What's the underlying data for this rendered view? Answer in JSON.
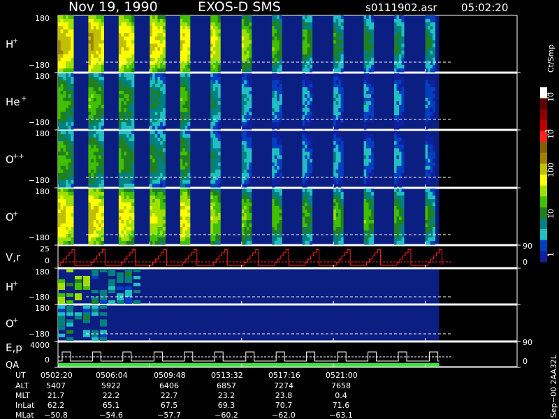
{
  "header": {
    "date": "Nov 19, 1990",
    "instrument": "EXOS-D SMS",
    "file": "s0111902.asr",
    "start_time": "05:02:20"
  },
  "colors": {
    "background": "#000000",
    "panel_bg": "#0b1e82",
    "dashed_line": "#ffffff",
    "vr_trace": "#ff2020",
    "qa_bar": "#40e040"
  },
  "colorbar": {
    "label": "Ct/Smp",
    "ticks": [
      "10",
      "10",
      "100",
      "10",
      "1"
    ],
    "tick_exponents": [
      "4",
      "3",
      "",
      "",
      ""
    ],
    "colors": [
      "#ffffff",
      "#600000",
      "#900000",
      "#c00000",
      "#ff2020",
      "#806000",
      "#a08000",
      "#c0c000",
      "#ffff00",
      "#a0e000",
      "#40c000",
      "#208020",
      "#008080",
      "#20c0c0",
      "#0040c0",
      "#1020a0"
    ]
  },
  "panels": [
    {
      "id": "h_plus",
      "label": "H",
      "sup": "+",
      "ytop": "180",
      "ybot": "−180"
    },
    {
      "id": "he_plus",
      "label": "He",
      "sup": "+",
      "ytop": "180",
      "ybot": "−180"
    },
    {
      "id": "o_plusplus",
      "label": "O",
      "sup": "++",
      "ytop": "180",
      "ybot": "−180"
    },
    {
      "id": "o_plus",
      "label": "O",
      "sup": "+",
      "ytop": "180",
      "ybot": "−180"
    },
    {
      "id": "vr",
      "label": "V,r",
      "sup": "",
      "ytop": "25",
      "ybot": "0",
      "right_top": "90",
      "right_bot": "0"
    },
    {
      "id": "h_plus_2",
      "label": "H",
      "sup": "+",
      "ytop": "180",
      "ybot": "−180"
    },
    {
      "id": "o_plus_2",
      "label": "O",
      "sup": "+",
      "ytop": "180",
      "ybot": "−180"
    },
    {
      "id": "ep_qa",
      "label": "E,p",
      "label2": "QA",
      "sup": "",
      "ytop": "4000",
      "ybot": "0",
      "right_top": "90",
      "right_bot": "0"
    }
  ],
  "ephemeris": {
    "labels": [
      "UT",
      "ALT",
      "MLT",
      "InLat",
      "MLat"
    ],
    "columns": [
      [
        "0502:20",
        "5407",
        "21.7",
        "62.2",
        "−50.8"
      ],
      [
        "0506:04",
        "5922",
        "22.2",
        "65.1",
        "−54.6"
      ],
      [
        "0509:48",
        "6406",
        "22.7",
        "67.5",
        "−57.7"
      ],
      [
        "0513:32",
        "6857",
        "23.2",
        "69.3",
        "−60.2"
      ],
      [
        "0517:16",
        "7274",
        "23.8",
        "70.7",
        "−62.0"
      ],
      [
        "0521:00",
        "7658",
        "0.4",
        "71.6",
        "−63.1"
      ]
    ]
  },
  "footer": {
    "version": "Sep−00 2AA32L"
  },
  "chart_data": {
    "type": "heatmap",
    "title": "Nov 19, 1990    EXOS-D SMS",
    "x_ticks": [
      "0502:20",
      "0506:04",
      "0509:48",
      "0513:32",
      "0517:16",
      "0521:00"
    ],
    "xlim": [
      "05:02:20",
      "05:21:00"
    ],
    "data_end": "05:17:50",
    "pitch_angle_range": [
      -180,
      180
    ],
    "burst_starts": [
      "05:02:20",
      "05:03:34",
      "05:04:48",
      "05:06:04",
      "05:07:18",
      "05:08:32",
      "05:09:48",
      "05:11:02",
      "05:12:16",
      "05:13:32",
      "05:14:46",
      "05:16:00",
      "05:17:16"
    ],
    "series": [
      {
        "name": "H+",
        "peak_counts": [
          200,
          220,
          150,
          140,
          130,
          100,
          60,
          30,
          25,
          20,
          18,
          15,
          14
        ]
      },
      {
        "name": "He+",
        "peak_counts": [
          30,
          35,
          25,
          15,
          30,
          12,
          8,
          6,
          5,
          6,
          5,
          5,
          4
        ]
      },
      {
        "name": "O++",
        "peak_counts": [
          30,
          30,
          25,
          18,
          25,
          12,
          8,
          5,
          5,
          6,
          5,
          5,
          4
        ]
      },
      {
        "name": "O+",
        "peak_counts": [
          150,
          170,
          120,
          80,
          120,
          60,
          40,
          30,
          25,
          30,
          30,
          25,
          20
        ]
      }
    ],
    "colorbar_range": [
      1,
      10000
    ],
    "colorbar_scale": "log"
  }
}
